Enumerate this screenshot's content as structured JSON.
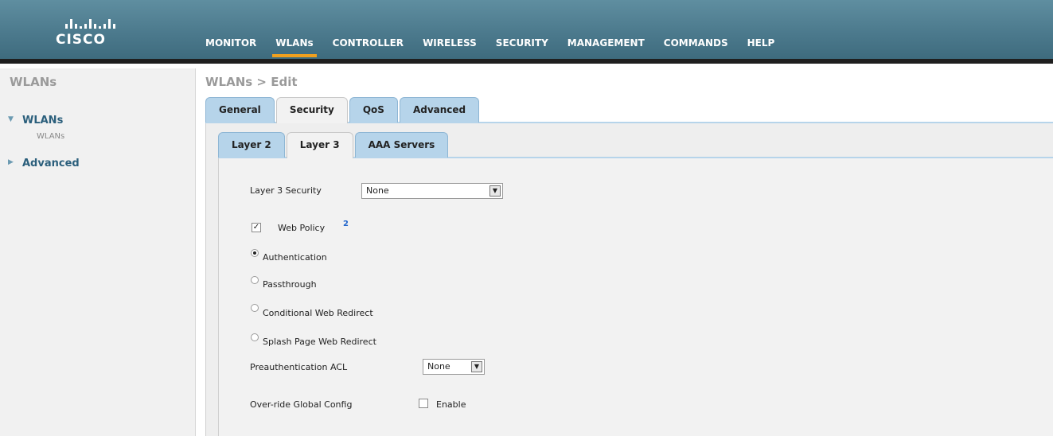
{
  "brand": {
    "name": "CISCO"
  },
  "nav": {
    "items": [
      {
        "label": "MONITOR"
      },
      {
        "label": "WLANs",
        "active": true
      },
      {
        "label": "CONTROLLER"
      },
      {
        "label": "WIRELESS"
      },
      {
        "label": "SECURITY"
      },
      {
        "label": "MANAGEMENT"
      },
      {
        "label": "COMMANDS"
      },
      {
        "label": "HELP"
      }
    ]
  },
  "sidebar": {
    "title": "WLANs",
    "items": [
      {
        "label": "WLANs",
        "expanded": true,
        "children": [
          "WLANs"
        ]
      },
      {
        "label": "Advanced",
        "expanded": false
      }
    ]
  },
  "page": {
    "title": "WLANs > Edit"
  },
  "tabs": {
    "primary": [
      {
        "label": "General"
      },
      {
        "label": "Security",
        "active": true
      },
      {
        "label": "QoS"
      },
      {
        "label": "Advanced"
      }
    ],
    "secondary": [
      {
        "label": "Layer 2"
      },
      {
        "label": "Layer 3",
        "active": true
      },
      {
        "label": "AAA Servers"
      }
    ]
  },
  "form": {
    "layer3_security_label": "Layer 3 Security",
    "layer3_security_value": "None",
    "web_policy_label": "Web Policy",
    "web_policy_checked": true,
    "web_policy_help": "2",
    "radio_options": [
      {
        "label": "Authentication",
        "selected": true
      },
      {
        "label": "Passthrough",
        "selected": false
      },
      {
        "label": "Conditional Web Redirect",
        "selected": false
      },
      {
        "label": "Splash Page Web Redirect",
        "selected": false
      }
    ],
    "preauth_acl_label": "Preauthentication ACL",
    "preauth_acl_value": "None",
    "override_label": "Over-ride Global Config",
    "override_enable_label": "Enable",
    "override_enabled": false
  },
  "colors": {
    "header": "#4c7a8d",
    "accent": "#f0a01e",
    "tab": "#b6d4ea",
    "sidebar_link": "#2b5f7c"
  }
}
